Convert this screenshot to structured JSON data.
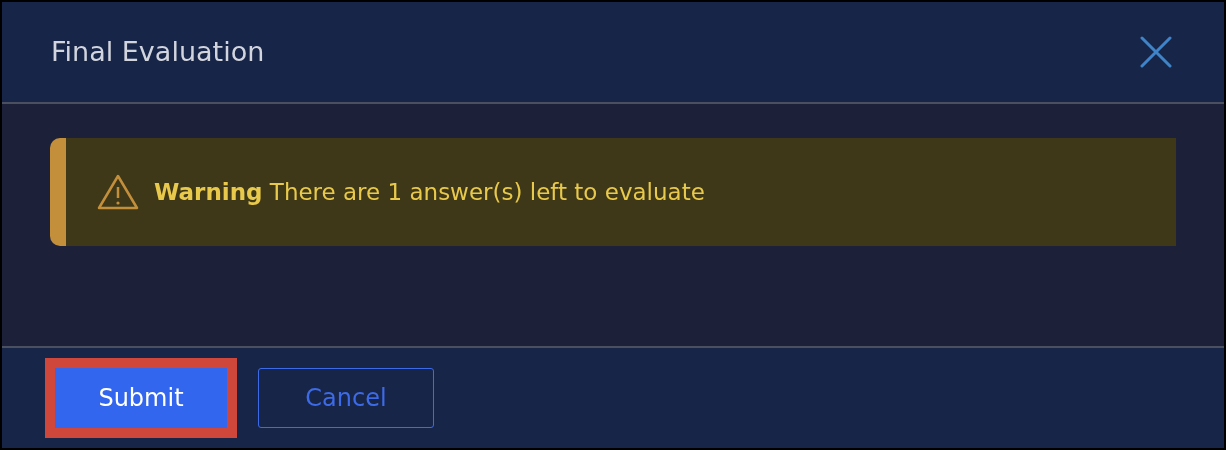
{
  "dialog": {
    "title": "Final Evaluation"
  },
  "alert": {
    "label": "Warning",
    "message": "There are 1 answer(s) left to evaluate"
  },
  "buttons": [
    {
      "label": "Submit",
      "kind": "primary",
      "highlighted": true
    },
    {
      "label": "Cancel",
      "kind": "secondary",
      "highlighted": false
    }
  ]
}
